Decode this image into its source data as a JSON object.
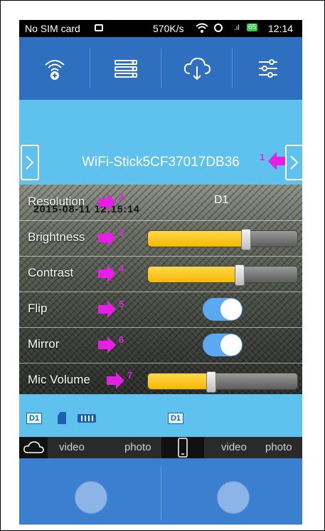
{
  "status_bar": {
    "carrier": "No SIM card",
    "speed": "570K/s",
    "battery": "65",
    "time": "12:14"
  },
  "toolbar": {
    "items": [
      {
        "icon": "wifi-add-icon"
      },
      {
        "icon": "device-list-icon"
      },
      {
        "icon": "cloud-download-icon"
      },
      {
        "icon": "settings-sliders-icon"
      }
    ]
  },
  "device": {
    "name": "WiFi-Stick5CF37017DB36"
  },
  "annotations": [
    "1",
    "2",
    "3",
    "4",
    "5",
    "6",
    "7"
  ],
  "overlay": {
    "timestamp": "2015-08-11 12:15:14"
  },
  "settings": {
    "resolution": {
      "label": "Resolution",
      "value": "D1"
    },
    "brightness": {
      "label": "Brightness",
      "level": 0.65
    },
    "contrast": {
      "label": "Contrast",
      "level": 0.61
    },
    "flip": {
      "label": "Flip",
      "on": true
    },
    "mirror": {
      "label": "Mirror",
      "on": true
    },
    "mic_volume": {
      "label": "Mic Volume",
      "level": 0.42
    }
  },
  "left_panel": {
    "badge": "D1",
    "tabs": {
      "video": "video",
      "photo": "photo"
    }
  },
  "right_panel": {
    "badge": "D1",
    "tabs": {
      "video": "video",
      "photo": "photo"
    }
  },
  "colors": {
    "accent_blue": "#2f6fc0",
    "light_blue": "#5fc2ee",
    "slider_fill": "#f5b800",
    "annotation": "#e61fe6"
  }
}
